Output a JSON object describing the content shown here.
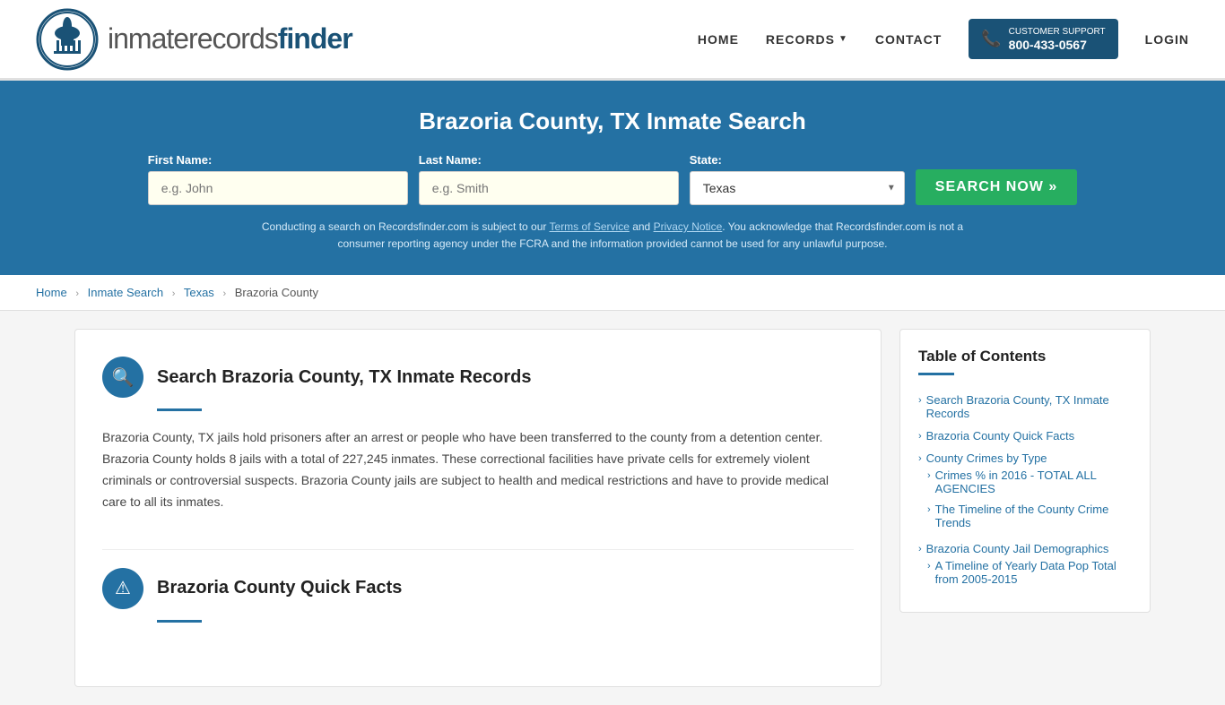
{
  "header": {
    "logo_text_inmate": "inmaterecords",
    "logo_text_finder": "finder",
    "nav": {
      "home": "HOME",
      "records": "RECORDS",
      "contact": "CONTACT",
      "login": "LOGIN"
    },
    "support": {
      "label": "CUSTOMER SUPPORT",
      "number": "800-433-0567"
    }
  },
  "hero": {
    "title": "Brazoria County, TX Inmate Search",
    "form": {
      "first_name_label": "First Name:",
      "first_name_placeholder": "e.g. John",
      "last_name_label": "Last Name:",
      "last_name_placeholder": "e.g. Smith",
      "state_label": "State:",
      "state_value": "Texas",
      "search_button": "SEARCH NOW »"
    },
    "disclaimer": "Conducting a search on Recordsfinder.com is subject to our Terms of Service and Privacy Notice. You acknowledge that Recordsfinder.com is not a consumer reporting agency under the FCRA and the information provided cannot be used for any unlawful purpose."
  },
  "breadcrumb": {
    "home": "Home",
    "inmate_search": "Inmate Search",
    "state": "Texas",
    "county": "Brazoria County"
  },
  "main_section": {
    "search_title": "Search Brazoria County, TX Inmate Records",
    "search_icon": "🔍",
    "search_body": "Brazoria County, TX jails hold prisoners after an arrest or people who have been transferred to the county from a detention center. Brazoria County holds 8 jails with a total of 227,245 inmates. These correctional facilities have private cells for extremely violent criminals or controversial suspects. Brazoria County jails are subject to health and medical restrictions and have to provide medical care to all its inmates.",
    "quick_facts_title": "Brazoria County Quick Facts",
    "quick_facts_icon": "⚠"
  },
  "toc": {
    "title": "Table of Contents",
    "items": [
      {
        "label": "Search Brazoria County, TX Inmate Records",
        "sub": []
      },
      {
        "label": "Brazoria County Quick Facts",
        "sub": []
      },
      {
        "label": "County Crimes by Type",
        "sub": [
          {
            "label": "Crimes % in 2016 - TOTAL ALL AGENCIES"
          },
          {
            "label": "The Timeline of the County Crime Trends"
          }
        ]
      },
      {
        "label": "Brazoria County Jail Demographics",
        "sub": [
          {
            "label": "A Timeline of Yearly Data Pop Total from 2005-2015"
          }
        ]
      }
    ]
  }
}
